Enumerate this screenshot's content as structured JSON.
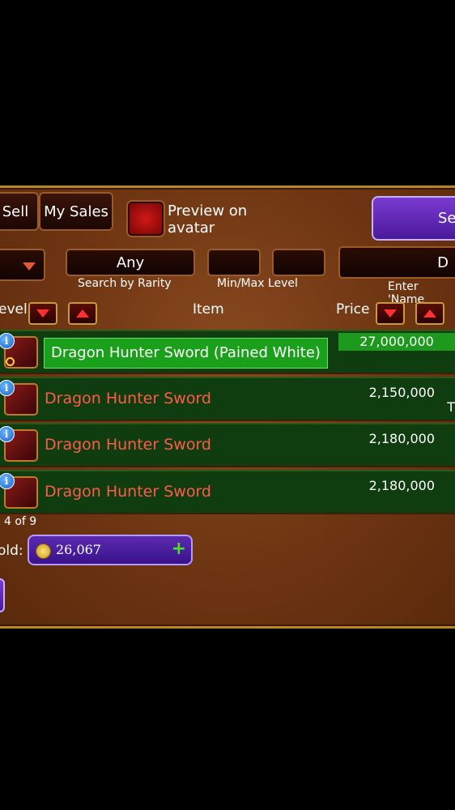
{
  "tabs": {
    "sell": "Sell",
    "my_sales": "My Sales"
  },
  "preview": {
    "label": "Preview on avatar",
    "line1": "Preview on",
    "line2": "avatar"
  },
  "search_button": {
    "label": "Se"
  },
  "filters": {
    "rarity_value": "Any",
    "rarity_caption": "Search by Rarity",
    "level_caption": "Min/Max Level",
    "name_value": "D",
    "name_caption": "Enter 'Name"
  },
  "columns": {
    "level": "evel",
    "item": "Item",
    "price": "Price"
  },
  "rows": [
    {
      "name": "Dragon Hunter Sword (Pained White)",
      "price": "27,000,000",
      "selected": true
    },
    {
      "name": "Dragon Hunter Sword",
      "price": "2,150,000",
      "extra": "T"
    },
    {
      "name": "Dragon Hunter Sword",
      "price": "2,180,000"
    },
    {
      "name": "Dragon Hunter Sword",
      "price": "2,180,000"
    }
  ],
  "pagination": "4 of 9",
  "gold": {
    "label": "old:",
    "amount": "26,067"
  },
  "colors": {
    "accent_purple": "#5a2ab0",
    "row_green": "#0f3d0f",
    "selected_green": "#1aa01a",
    "item_red": "#ff5a4a"
  }
}
